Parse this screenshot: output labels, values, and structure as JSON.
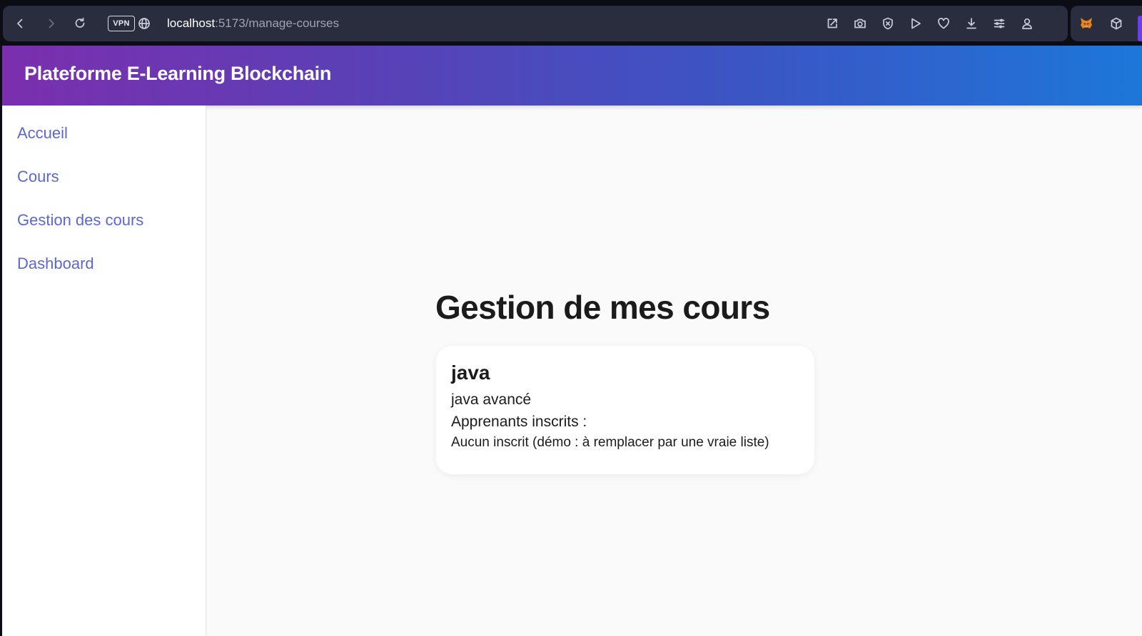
{
  "browser": {
    "vpn_label": "VPN",
    "url_host": "localhost",
    "url_path": ":5173/manage-courses",
    "icons": [
      "back-icon",
      "forward-icon",
      "reload-icon",
      "globe-icon",
      "share-icon",
      "camera-icon",
      "shield-icon",
      "play-icon",
      "heart-icon",
      "download-icon",
      "menu-icon",
      "profile-icon",
      "fox-extension-icon",
      "cube-extension-icon"
    ]
  },
  "header": {
    "title": "Plateforme E-Learning Blockchain"
  },
  "sidebar": {
    "items": [
      {
        "label": "Accueil"
      },
      {
        "label": "Cours"
      },
      {
        "label": "Gestion des cours"
      },
      {
        "label": "Dashboard"
      }
    ]
  },
  "main": {
    "title": "Gestion de mes cours",
    "courses": [
      {
        "title": "java",
        "description": "java avancé",
        "enrolled_label": "Apprenants inscrits :",
        "enrolled_empty": "Aucun inscrit (démo : à remplacer par une vraie liste)"
      }
    ]
  },
  "colors": {
    "header_gradient_start": "#7b2fae",
    "header_gradient_end": "#1d77d9",
    "nav_link": "#5b67d4",
    "page_bg": "#fafafa"
  }
}
